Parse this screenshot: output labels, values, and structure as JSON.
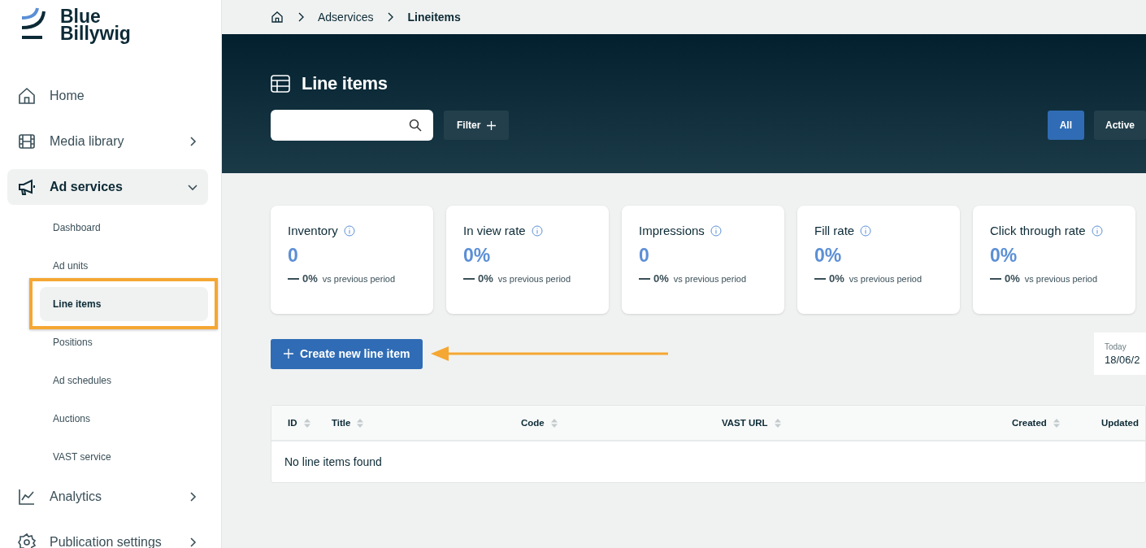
{
  "brand": {
    "line1": "Blue",
    "line2": "Billywig"
  },
  "sidebar": {
    "items": [
      {
        "label": "Home",
        "expandable": false,
        "selected": false
      },
      {
        "label": "Media library",
        "expandable": true,
        "expanded": false,
        "selected": false
      },
      {
        "label": "Ad services",
        "expandable": true,
        "expanded": true,
        "selected": true,
        "children": [
          {
            "label": "Dashboard",
            "selected": false,
            "highlighted": false
          },
          {
            "label": "Ad units",
            "selected": false,
            "highlighted": false
          },
          {
            "label": "Line items",
            "selected": true,
            "highlighted": true
          },
          {
            "label": "Positions",
            "selected": false,
            "highlighted": false
          },
          {
            "label": "Ad schedules",
            "selected": false,
            "highlighted": false
          },
          {
            "label": "Auctions",
            "selected": false,
            "highlighted": false
          },
          {
            "label": "VAST service",
            "selected": false,
            "highlighted": false
          }
        ]
      },
      {
        "label": "Analytics",
        "expandable": true,
        "expanded": false,
        "selected": false
      },
      {
        "label": "Publication settings",
        "expandable": true,
        "expanded": false,
        "selected": false
      }
    ]
  },
  "breadcrumb": [
    "Adservices",
    "Lineitems"
  ],
  "header": {
    "title": "Line items",
    "filter": "Filter",
    "status_tabs": [
      {
        "label": "All",
        "selected": true
      },
      {
        "label": "Active",
        "selected": false
      }
    ]
  },
  "stats": [
    {
      "label": "Inventory",
      "value": "0",
      "change": "0%",
      "note": "vs previous period"
    },
    {
      "label": "In view rate",
      "value": "0%",
      "change": "0%",
      "note": "vs previous period"
    },
    {
      "label": "Impressions",
      "value": "0",
      "change": "0%",
      "note": "vs previous period"
    },
    {
      "label": "Fill rate",
      "value": "0%",
      "change": "0%",
      "note": "vs previous period"
    },
    {
      "label": "Click through rate",
      "value": "0%",
      "change": "0%",
      "note": "vs previous period"
    }
  ],
  "create_button": {
    "label": "Create new line item",
    "pointed_at": true
  },
  "date": {
    "label": "Today",
    "value": "18/06/2"
  },
  "table": {
    "columns": [
      {
        "label": "ID",
        "sortable": true
      },
      {
        "label": "Title",
        "sortable": true
      },
      {
        "label": "Code",
        "sortable": true
      },
      {
        "label": "VAST URL",
        "sortable": true
      },
      {
        "label": "Created",
        "sortable": true
      },
      {
        "label": "Updated"
      }
    ],
    "empty": "No line items found"
  }
}
